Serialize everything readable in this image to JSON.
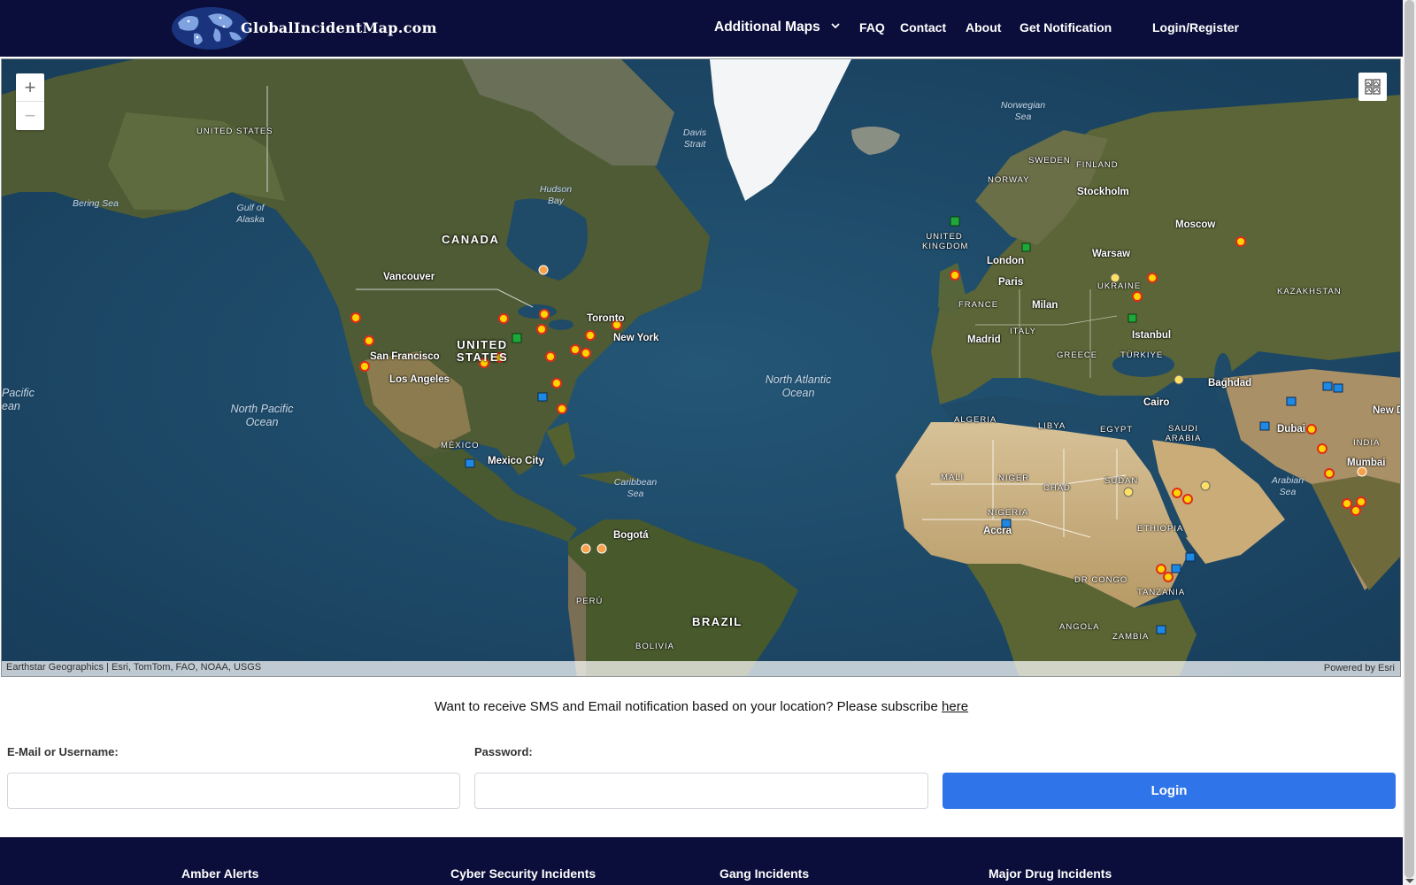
{
  "header": {
    "logo_text": "GlobalIncidentMap.com",
    "logo_icon": "globe-logo-icon",
    "nav": [
      {
        "label": "Additional Maps",
        "icon": "chevron-down-icon"
      },
      {
        "label": "FAQ"
      },
      {
        "label": "Contact"
      },
      {
        "label": "About"
      },
      {
        "label": "Get Notification"
      },
      {
        "label": "Login/Register"
      }
    ]
  },
  "map": {
    "zoom_in": "+",
    "zoom_out": "−",
    "basemap_toggle_icon": "basemap-gallery-icon",
    "attribution": "Earthstar Geographics | Esri, TomTom, FAO, NOAA, USGS",
    "powered_by": "Powered by Esri",
    "labels": {
      "countries": [
        "UNITED STATES",
        "CANADA",
        "UNITED STATES",
        "MÉXICO",
        "BRAZIL",
        "PERÚ",
        "BOLIVIA",
        "UNITED KINGDOM",
        "FRANCE",
        "ITALY",
        "GREECE",
        "TÜRKIYE",
        "UKRAINE",
        "NORWAY",
        "SWEDEN",
        "FINLAND",
        "KAZAKHSTAN",
        "ALGERIA",
        "LIBYA",
        "EGYPT",
        "MALI",
        "NIGER",
        "CHAD",
        "SUDAN",
        "NIGERIA",
        "ETHIOPIA",
        "SAUDI ARABIA",
        "DR CONGO",
        "TANZANIA",
        "ANGOLA",
        "ZAMBIA",
        "INDIA"
      ],
      "cities": [
        "Vancouver",
        "San Francisco",
        "Los Angeles",
        "Toronto",
        "New York",
        "Mexico City",
        "Bogotá",
        "London",
        "Paris",
        "Milan",
        "Madrid",
        "Warsaw",
        "Stockholm",
        "Moscow",
        "Istanbul",
        "Cairo",
        "Baghdad",
        "Dubai",
        "Mumbai",
        "New D",
        "Accra"
      ],
      "oceans": [
        "North Pacific Ocean",
        "North Atlantic Ocean",
        "Pacific ean"
      ],
      "seas": [
        "Bering Sea",
        "Gulf of Alaska",
        "Hudson Bay",
        "Davis Strait",
        "Norwegian Sea",
        "Caribbean Sea",
        "Arabian Sea"
      ]
    }
  },
  "subscribe": {
    "text": "Want to receive SMS and Email notification based on your location? Please subscribe ",
    "link": "here"
  },
  "login": {
    "username_label": "E-Mail or Username:",
    "username_value": "",
    "password_label": "Password:",
    "password_value": "",
    "button": "Login"
  },
  "footer": {
    "links": [
      "Amber Alerts",
      "Cyber Security Incidents",
      "Gang Incidents",
      "Major Drug Incidents"
    ]
  },
  "colors": {
    "header_bg": "#0b0e3a",
    "login_button": "#2f74e8",
    "ocean": "#1d4a6a",
    "land": "#4d5a33",
    "desert": "#cdb487",
    "ice": "#f4f6f7",
    "incident_marker": "#ffd400"
  }
}
